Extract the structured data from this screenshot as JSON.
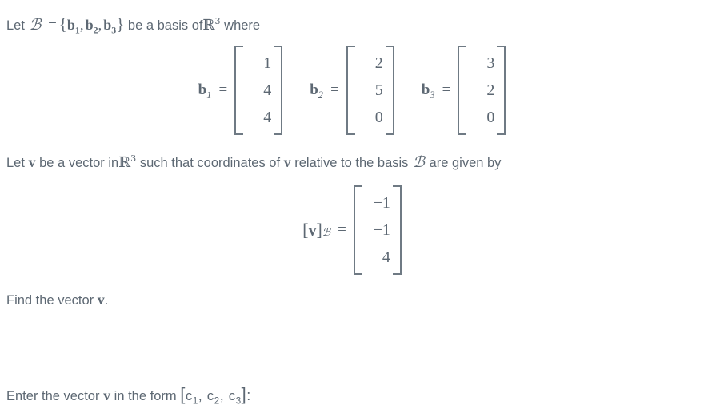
{
  "document": {
    "type": "math-problem",
    "background_color": "#ffffff",
    "text_color": "#5d6873",
    "bracket_color": "#6f7a84"
  },
  "line1": {
    "prefix": "Let",
    "basis_symbol": "ℬ",
    "equals": "=",
    "open_brace": "{",
    "b_letter": "b",
    "sub1": "1",
    "sub2": "2",
    "sub3": "3",
    "comma": ",",
    "close_brace": "}",
    "middle": "be a basis of",
    "R_symbol": "ℝ",
    "R_exponent": "3",
    "suffix": "where"
  },
  "basis_vectors": [
    {
      "label_letter": "b",
      "label_sub": "1",
      "equals": "=",
      "entries": [
        "1",
        "4",
        "4"
      ]
    },
    {
      "label_letter": "b",
      "label_sub": "2",
      "equals": "=",
      "entries": [
        "2",
        "5",
        "0"
      ]
    },
    {
      "label_letter": "b",
      "label_sub": "3",
      "equals": "=",
      "entries": [
        "3",
        "2",
        "0"
      ]
    }
  ],
  "line2": {
    "prefix": "Let",
    "v_symbol": "v",
    "middle1": "be a vector in",
    "R_symbol": "ℝ",
    "R_exponent": "3",
    "middle2": "such that coordinates of",
    "v_symbol2": "v",
    "middle3": "relative to the basis",
    "basis_symbol": "ℬ",
    "suffix": "are given by"
  },
  "coordinate_vector": {
    "open_bracket": "[",
    "v_symbol": "v",
    "close_bracket": "]",
    "subscript_basis": "ℬ",
    "equals": "=",
    "entries": [
      "−1",
      "−1",
      "4"
    ]
  },
  "line3": {
    "prefix": "Find the vector",
    "v_symbol": "v",
    "suffix": "."
  },
  "line4": {
    "prefix": "Enter the vector",
    "v_symbol": "v",
    "middle": "in the form",
    "open_bracket": "[",
    "c_letter1": "c",
    "c_sub1": "1",
    "comma1": ",",
    "c_letter2": "c",
    "c_sub2": "2",
    "comma2": ",",
    "c_letter3": "c",
    "c_sub3": "3",
    "close_bracket": "]",
    "colon": ":"
  }
}
